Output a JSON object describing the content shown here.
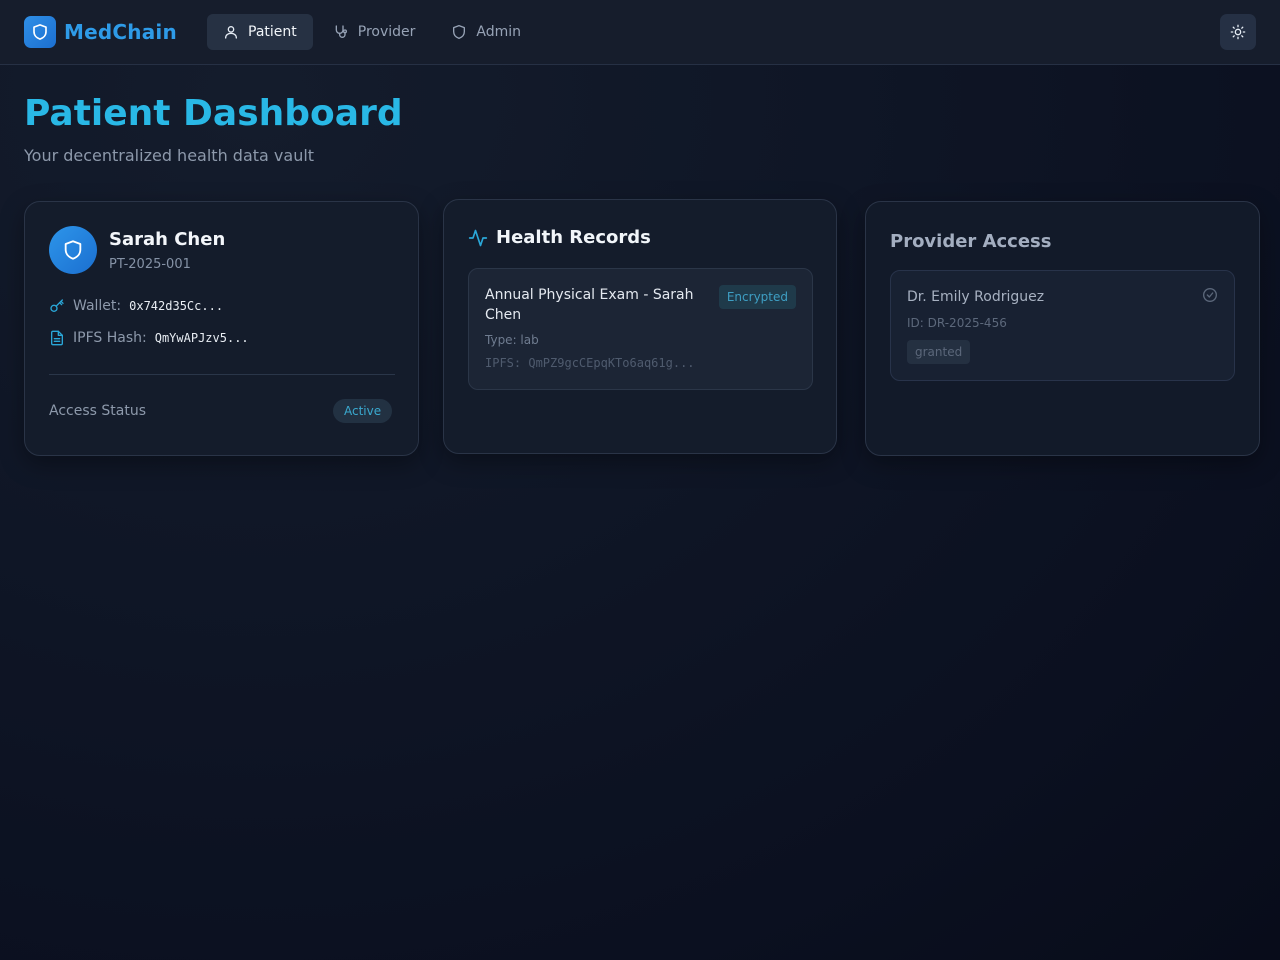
{
  "brand": {
    "name": "MedChain"
  },
  "nav": {
    "items": [
      {
        "label": "Patient",
        "icon": "user-icon",
        "active": true
      },
      {
        "label": "Provider",
        "icon": "stethoscope-icon",
        "active": false
      },
      {
        "label": "Admin",
        "icon": "shield-icon",
        "active": false
      }
    ],
    "theme_toggle_icon": "sun-icon"
  },
  "page": {
    "title": "Patient Dashboard",
    "subtitle": "Your decentralized health data vault"
  },
  "patient": {
    "name": "Sarah Chen",
    "id": "PT-2025-001",
    "wallet_label": "Wallet:",
    "wallet_value": "0x742d35Cc...",
    "ipfs_label": "IPFS Hash:",
    "ipfs_value": "QmYwAPJzv5...",
    "status_label": "Access Status",
    "status_value": "Active"
  },
  "records": {
    "title": "Health Records",
    "items": [
      {
        "name": "Annual Physical Exam - Sarah Chen",
        "badge": "Encrypted",
        "type": "Type: lab",
        "ipfs": "IPFS: QmPZ9gcCEpqKTo6aq61g..."
      }
    ]
  },
  "access": {
    "title": "Provider Access",
    "providers": [
      {
        "name": "Dr. Emily Rodriguez",
        "id": "ID: DR-2025-456",
        "status": "granted"
      }
    ]
  },
  "colors": {
    "accent": "#29b8e6",
    "brand": "#2e9be8",
    "background": "#0f1626",
    "card": "#141c2b"
  }
}
